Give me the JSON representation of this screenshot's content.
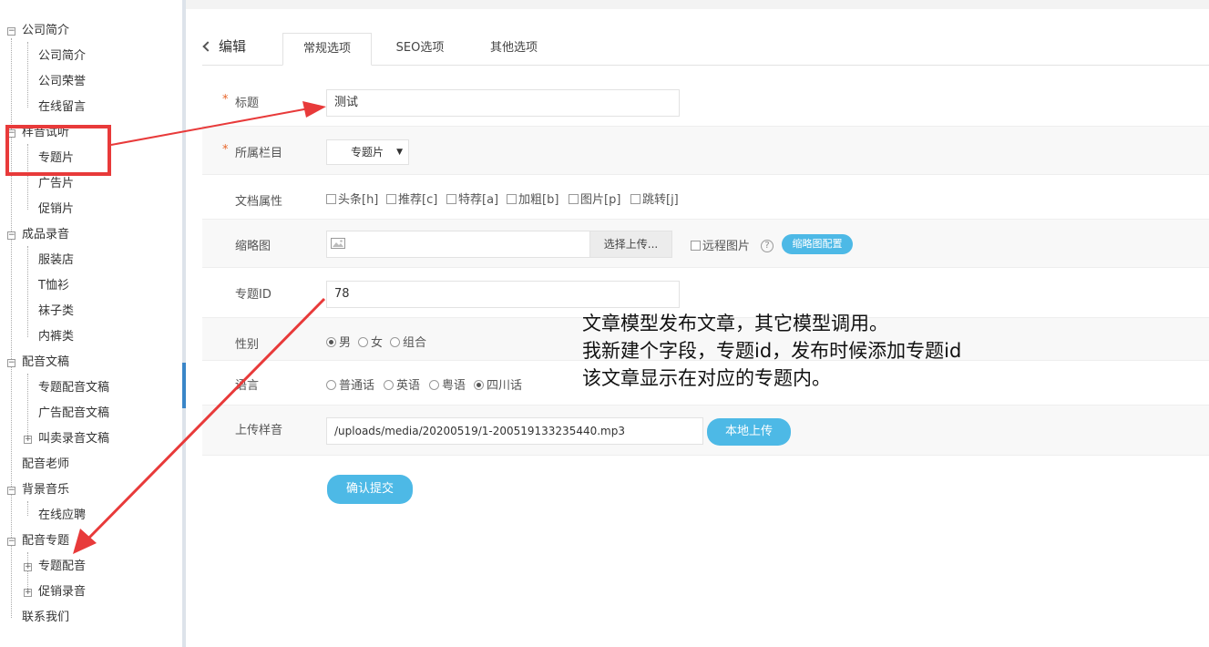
{
  "sidebar": {
    "items": [
      {
        "label": "公司简介",
        "level": 0,
        "toggle": "−"
      },
      {
        "label": "公司简介",
        "level": 1
      },
      {
        "label": "公司荣誉",
        "level": 1
      },
      {
        "label": "在线留言",
        "level": 1
      },
      {
        "label": "样音试听",
        "level": 0,
        "toggle": "−"
      },
      {
        "label": "专题片",
        "level": 1
      },
      {
        "label": "广告片",
        "level": 1
      },
      {
        "label": "促销片",
        "level": 1
      },
      {
        "label": "成品录音",
        "level": 0,
        "toggle": "−"
      },
      {
        "label": "服装店",
        "level": 1
      },
      {
        "label": "T恤衫",
        "level": 1
      },
      {
        "label": "袜子类",
        "level": 1
      },
      {
        "label": "内裤类",
        "level": 1
      },
      {
        "label": "配音文稿",
        "level": 0,
        "toggle": "−"
      },
      {
        "label": "专题配音文稿",
        "level": 1
      },
      {
        "label": "广告配音文稿",
        "level": 1
      },
      {
        "label": "叫卖录音文稿",
        "level": 1,
        "toggle": "+"
      },
      {
        "label": "配音老师",
        "level": 0
      },
      {
        "label": "背景音乐",
        "level": 0,
        "toggle": "−"
      },
      {
        "label": "在线应聘",
        "level": 1
      },
      {
        "label": "配音专题",
        "level": 0,
        "toggle": "−"
      },
      {
        "label": "专题配音",
        "level": 1,
        "toggle": "+"
      },
      {
        "label": "促销录音",
        "level": 1,
        "toggle": "+"
      },
      {
        "label": "联系我们",
        "level": 0
      }
    ]
  },
  "header": {
    "back_label": "编辑",
    "tabs": [
      {
        "label": "常规选项"
      },
      {
        "label": "SEO选项"
      },
      {
        "label": "其他选项"
      }
    ]
  },
  "form": {
    "title_label": "标题",
    "title_value": "测试",
    "column_label": "所属栏目",
    "column_value": "专题片",
    "attr_label": "文档属性",
    "attrs": [
      "头条[h]",
      "推荐[c]",
      "特荐[a]",
      "加粗[b]",
      "图片[p]",
      "跳转[j]"
    ],
    "thumb_label": "缩略图",
    "thumb_button": "选择上传...",
    "thumb_remote": "远程图片",
    "thumb_config": "缩略图配置",
    "topic_label": "专题ID",
    "topic_value": "78",
    "gender_label": "性别",
    "genders": [
      "男",
      "女",
      "组合"
    ],
    "language_label": "语言",
    "languages": [
      "普通话",
      "英语",
      "粤语",
      "四川话"
    ],
    "audio_label": "上传样音",
    "audio_value": "/uploads/media/20200519/1-200519133235440.mp3",
    "audio_button": "本地上传",
    "submit": "确认提交",
    "required_mark": "*"
  },
  "annotation": {
    "line1": "文章模型发布文章，其它模型调用。",
    "line2": "我新建个字段，专题id，发布时候添加专题id",
    "line3": "该文章显示在对应的专题内。"
  },
  "colors": {
    "accent": "#4db9e6",
    "annotation_red": "#e83a3a",
    "required": "#e8662a"
  }
}
